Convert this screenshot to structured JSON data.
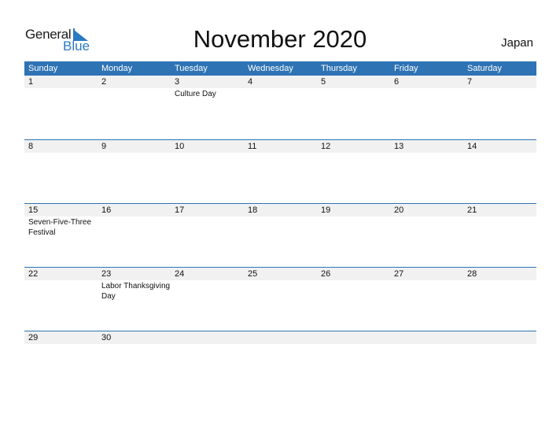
{
  "logo": {
    "general": "General",
    "blue": "Blue"
  },
  "title": "November 2020",
  "country": "Japan",
  "weekdays": [
    "Sunday",
    "Monday",
    "Tuesday",
    "Wednesday",
    "Thursday",
    "Friday",
    "Saturday"
  ],
  "weeks": [
    {
      "days": [
        "1",
        "2",
        "3",
        "4",
        "5",
        "6",
        "7"
      ],
      "events": [
        "",
        "",
        "Culture Day",
        "",
        "",
        "",
        ""
      ]
    },
    {
      "days": [
        "8",
        "9",
        "10",
        "11",
        "12",
        "13",
        "14"
      ],
      "events": [
        "",
        "",
        "",
        "",
        "",
        "",
        ""
      ]
    },
    {
      "days": [
        "15",
        "16",
        "17",
        "18",
        "19",
        "20",
        "21"
      ],
      "events": [
        "Seven-Five-Three Festival",
        "",
        "",
        "",
        "",
        "",
        ""
      ]
    },
    {
      "days": [
        "22",
        "23",
        "24",
        "25",
        "26",
        "27",
        "28"
      ],
      "events": [
        "",
        "Labor Thanksgiving Day",
        "",
        "",
        "",
        "",
        ""
      ]
    },
    {
      "days": [
        "29",
        "30",
        "",
        "",
        "",
        "",
        ""
      ],
      "events": [
        "",
        "",
        "",
        "",
        "",
        "",
        ""
      ]
    }
  ],
  "colors": {
    "header_bg": "#2e73b4",
    "logo_blue": "#2a7ac0",
    "day_row_bg": "#f1f1f1"
  }
}
